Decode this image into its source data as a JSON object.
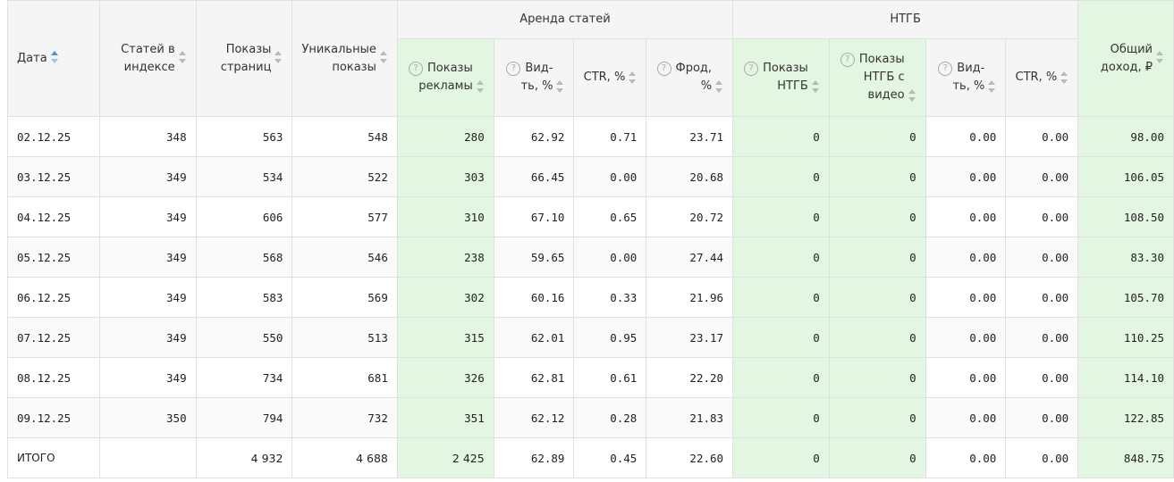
{
  "header": {
    "group_rent": "Аренда статей",
    "group_ntgb": "НТГБ",
    "col_date": "Дата",
    "col_articles": "Статей в индексе",
    "col_pageviews": "Показы страниц",
    "col_unique": "Уникальные показы",
    "col_ad_views": "Показы рекламы",
    "col_visibility": "Вид-ть, %",
    "col_ctr": "CTR, %",
    "col_fraud": "Фрод, %",
    "col_ntgb_views": "Показы НТГБ",
    "col_ntgb_video": "Показы НТГБ с видео",
    "col_ntgb_visibility": "Вид-ть, %",
    "col_ntgb_ctr": "CTR, %",
    "col_income": "Общий доход, ₽",
    "help_icon": "?"
  },
  "rows": [
    {
      "date": "02.12.25",
      "articles": "348",
      "pageviews": "563",
      "unique": "548",
      "ad_views": "280",
      "visibility": "62.92",
      "ctr": "0.71",
      "fraud": "23.71",
      "ntgb_views": "0",
      "ntgb_video": "0",
      "ntgb_visibility": "0.00",
      "ntgb_ctr": "0.00",
      "income": "98.00"
    },
    {
      "date": "03.12.25",
      "articles": "349",
      "pageviews": "534",
      "unique": "522",
      "ad_views": "303",
      "visibility": "66.45",
      "ctr": "0.00",
      "fraud": "20.68",
      "ntgb_views": "0",
      "ntgb_video": "0",
      "ntgb_visibility": "0.00",
      "ntgb_ctr": "0.00",
      "income": "106.05"
    },
    {
      "date": "04.12.25",
      "articles": "349",
      "pageviews": "606",
      "unique": "577",
      "ad_views": "310",
      "visibility": "67.10",
      "ctr": "0.65",
      "fraud": "20.72",
      "ntgb_views": "0",
      "ntgb_video": "0",
      "ntgb_visibility": "0.00",
      "ntgb_ctr": "0.00",
      "income": "108.50"
    },
    {
      "date": "05.12.25",
      "articles": "349",
      "pageviews": "568",
      "unique": "546",
      "ad_views": "238",
      "visibility": "59.65",
      "ctr": "0.00",
      "fraud": "27.44",
      "ntgb_views": "0",
      "ntgb_video": "0",
      "ntgb_visibility": "0.00",
      "ntgb_ctr": "0.00",
      "income": "83.30"
    },
    {
      "date": "06.12.25",
      "articles": "349",
      "pageviews": "583",
      "unique": "569",
      "ad_views": "302",
      "visibility": "60.16",
      "ctr": "0.33",
      "fraud": "21.96",
      "ntgb_views": "0",
      "ntgb_video": "0",
      "ntgb_visibility": "0.00",
      "ntgb_ctr": "0.00",
      "income": "105.70"
    },
    {
      "date": "07.12.25",
      "articles": "349",
      "pageviews": "550",
      "unique": "513",
      "ad_views": "315",
      "visibility": "62.01",
      "ctr": "0.95",
      "fraud": "23.17",
      "ntgb_views": "0",
      "ntgb_video": "0",
      "ntgb_visibility": "0.00",
      "ntgb_ctr": "0.00",
      "income": "110.25"
    },
    {
      "date": "08.12.25",
      "articles": "349",
      "pageviews": "734",
      "unique": "681",
      "ad_views": "326",
      "visibility": "62.81",
      "ctr": "0.61",
      "fraud": "22.20",
      "ntgb_views": "0",
      "ntgb_video": "0",
      "ntgb_visibility": "0.00",
      "ntgb_ctr": "0.00",
      "income": "114.10"
    },
    {
      "date": "09.12.25",
      "articles": "350",
      "pageviews": "794",
      "unique": "732",
      "ad_views": "351",
      "visibility": "62.12",
      "ctr": "0.28",
      "fraud": "21.83",
      "ntgb_views": "0",
      "ntgb_video": "0",
      "ntgb_visibility": "0.00",
      "ntgb_ctr": "0.00",
      "income": "122.85"
    }
  ],
  "totals": {
    "label": "ИТОГО",
    "articles": "",
    "pageviews": "4 932",
    "unique": "4 688",
    "ad_views": "2 425",
    "visibility": "62.89",
    "ctr": "0.45",
    "fraud": "22.60",
    "ntgb_views": "0",
    "ntgb_video": "0",
    "ntgb_visibility": "0.00",
    "ntgb_ctr": "0.00",
    "income": "848.75"
  },
  "colors": {
    "green_bg": "#e3f6e1",
    "header_bg": "#f5f5f5",
    "sort_active": "#4a8fe0",
    "border": "#e0e0e0"
  }
}
